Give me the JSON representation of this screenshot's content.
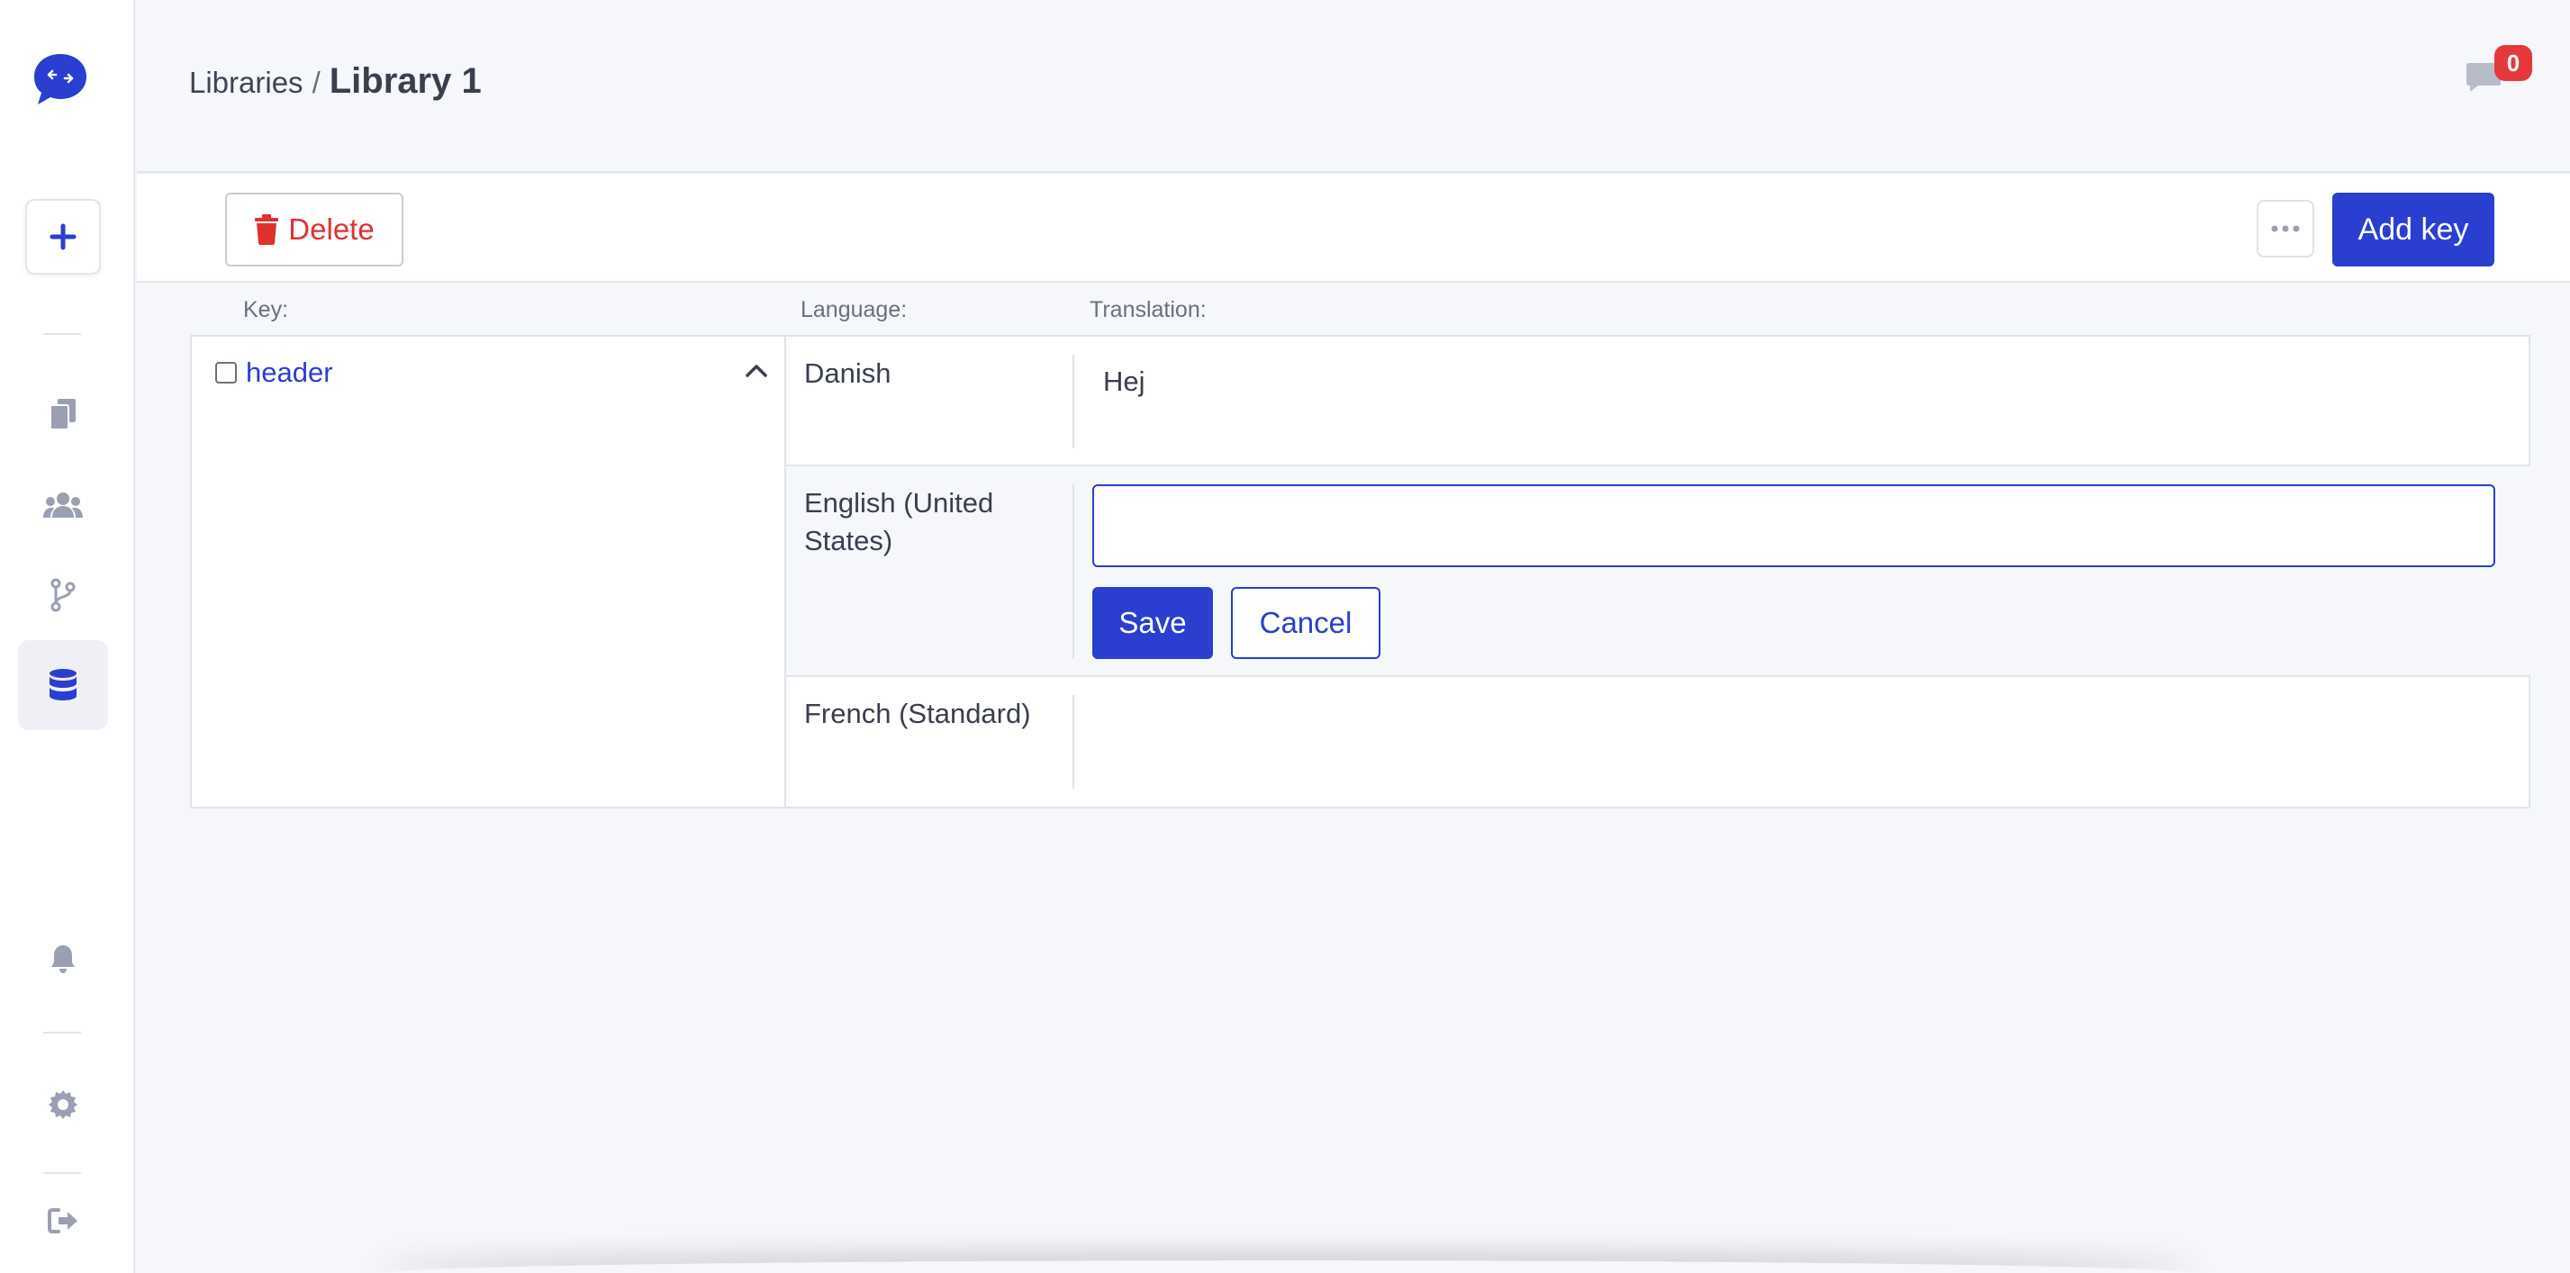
{
  "colors": {
    "accent": "#2a3fd0",
    "danger": "#e03131",
    "badge": "#e5383b",
    "icon_muted": "#9aa0b2",
    "background": "#f6f7fb"
  },
  "sidebar": {
    "logo_icon": "chat-bubble-logo-icon",
    "new_button_icon": "plus-icon",
    "items": [
      {
        "name": "documents",
        "icon": "documents-icon"
      },
      {
        "name": "team",
        "icon": "users-icon"
      },
      {
        "name": "branches",
        "icon": "branch-icon"
      },
      {
        "name": "libraries",
        "icon": "database-icon",
        "active": true
      }
    ],
    "bottom": [
      {
        "name": "notifications",
        "icon": "bell-icon"
      },
      {
        "name": "settings",
        "icon": "gear-icon"
      },
      {
        "name": "logout",
        "icon": "logout-icon"
      }
    ]
  },
  "header": {
    "breadcrumb_parent": "Libraries",
    "breadcrumb_sep": "/",
    "breadcrumb_current": "Library 1",
    "chat_badge_count": "0"
  },
  "toolbar": {
    "delete_label": "Delete",
    "more_icon": "ellipsis-icon",
    "add_key_label": "Add key"
  },
  "columns": {
    "key": "Key:",
    "language": "Language:",
    "translation": "Translation:"
  },
  "entry": {
    "key_name": "header",
    "expanded": true,
    "rows": [
      {
        "language": "Danish",
        "translation": "Hej"
      },
      {
        "language": "English (United States)",
        "translation": "",
        "editing": true
      },
      {
        "language": "French (Standard)",
        "translation": ""
      }
    ],
    "save_label": "Save",
    "cancel_label": "Cancel"
  }
}
